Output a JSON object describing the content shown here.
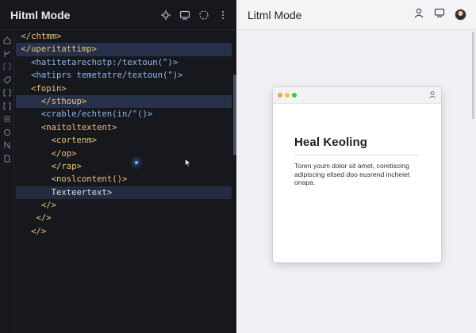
{
  "editor": {
    "title": "Hitml Mode",
    "header_icons": [
      "gear-icon",
      "monitor-icon",
      "loader-icon",
      "more-icon"
    ],
    "gutter_icons": [
      "home-icon",
      "branch-icon",
      "bracket-icon",
      "tag-icon",
      "bracket-icon",
      "bracket-icon",
      "list-icon",
      "circle-icon",
      "n-icon",
      "file-icon"
    ],
    "lines": [
      {
        "indent": 0,
        "text": "</chtmm>"
      },
      {
        "indent": 0,
        "text": "</uperitattimp>"
      },
      {
        "indent": 2,
        "text": "<hatitetarechotp:/textoun(\")>"
      },
      {
        "indent": 2,
        "text": "<hatiprs temetatre/textoun(\")>"
      },
      {
        "indent": 2,
        "text": "<fopin>"
      },
      {
        "indent": 4,
        "text": "</sthoup>"
      },
      {
        "indent": 4,
        "text": "<crable/echten(in/\"()>"
      },
      {
        "indent": 4,
        "text": "<naitoltextent>"
      },
      {
        "indent": 6,
        "text": "<cortenm>"
      },
      {
        "indent": 6,
        "text": "</op>"
      },
      {
        "indent": 6,
        "text": "</rap>"
      },
      {
        "indent": 6,
        "text": "<noslcontent()>"
      },
      {
        "indent": 6,
        "text": "Texteertext>"
      },
      {
        "indent": 4,
        "text": "</>"
      },
      {
        "indent": 3,
        "text": "</>"
      },
      {
        "indent": 2,
        "text": "</>"
      }
    ]
  },
  "preview": {
    "title": "Litml Mode",
    "header_icons": [
      "user-icon",
      "monitor-icon",
      "avatar"
    ],
    "window": {
      "dot_colors": [
        "#f0a23b",
        "#f5c23c",
        "#34c759"
      ],
      "heading": "Heal Keoling",
      "body": "Toren youm dolor sit amet, coretiscing adipiscing elised doo eusrend incheiet onapa."
    }
  },
  "colors": {
    "editor_bg": "#16181e",
    "tag": "#e9c176",
    "attr": "#8fb7ea",
    "highlight": "#27324a",
    "preview_bg": "#eff1f4"
  }
}
